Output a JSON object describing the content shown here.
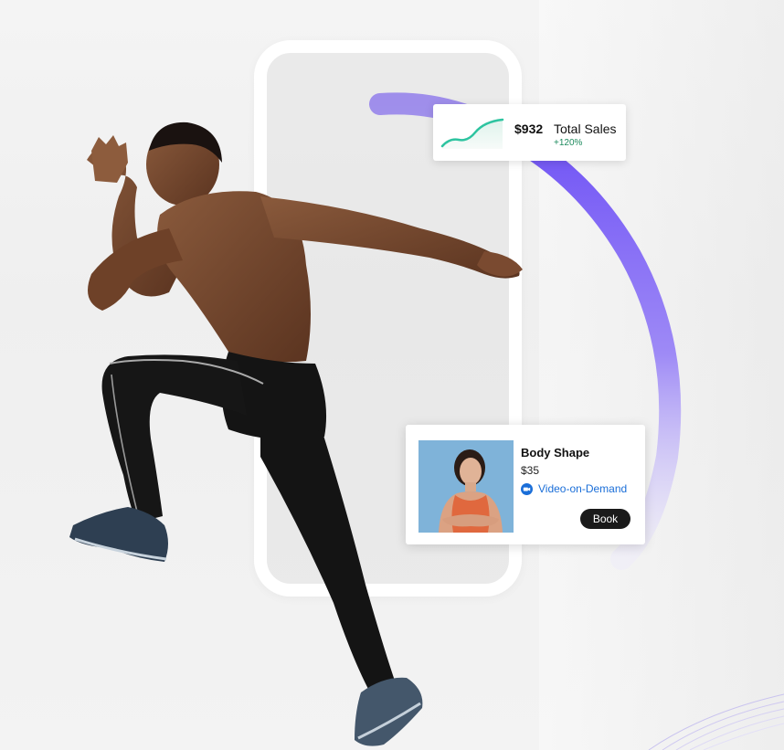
{
  "sales_card": {
    "amount": "$932",
    "label": "Total Sales",
    "change": "+120%",
    "trend_icon": "sparkline-chart-icon",
    "accent_color": "#2ec4a0"
  },
  "booking_card": {
    "class_name": "Body Shape",
    "price": "$35",
    "delivery_label": "Video-on-Demand",
    "delivery_icon": "video-camera-icon",
    "book_label": "Book",
    "link_color": "#1a6ed8"
  },
  "decor": {
    "arc_color_start": "#6a4cf5",
    "arc_color_end": "#e9e5fb",
    "phone_frame_color": "#ffffff"
  }
}
